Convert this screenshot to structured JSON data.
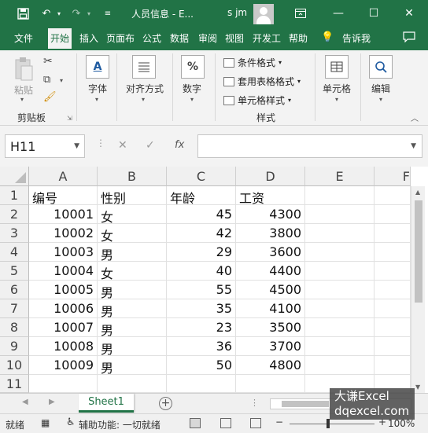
{
  "titlebar": {
    "title": "人员信息 - E...",
    "user": "s jm",
    "window": {
      "minimize": "—",
      "maximize": "☐",
      "close": "✕"
    },
    "icons": [
      "save-icon",
      "undo-icon",
      "redo-icon",
      "customize-qat-icon",
      "ribbon-display-icon"
    ]
  },
  "tabs": {
    "items": [
      "文件",
      "开始",
      "插入",
      "页面布",
      "公式",
      "数据",
      "审阅",
      "视图",
      "开发工",
      "帮助"
    ],
    "active": "开始",
    "tell_me": "告诉我"
  },
  "ribbon": {
    "clipboard": {
      "paste": "粘贴",
      "group_label": "剪贴板"
    },
    "font": {
      "label": "字体",
      "icon_text": "A"
    },
    "alignment": {
      "label": "对齐方式"
    },
    "number": {
      "label": "数字",
      "icon_text": "%"
    },
    "styles": {
      "conditional": "条件格式",
      "table": "套用表格格式",
      "cell_styles": "单元格样式",
      "group_label": "样式"
    },
    "cells": {
      "label": "单元格"
    },
    "editing": {
      "label": "编辑"
    }
  },
  "formula_bar": {
    "name_box": "H11",
    "cancel": "✕",
    "enter": "✓",
    "fx": "fx",
    "formula": ""
  },
  "grid": {
    "columns": [
      "A",
      "B",
      "C",
      "D",
      "E",
      "F"
    ],
    "rows": [
      "1",
      "2",
      "3",
      "4",
      "5",
      "6",
      "7",
      "8",
      "9",
      "10",
      "11"
    ],
    "data": [
      [
        "编号",
        "性别",
        "年龄",
        "工资"
      ],
      [
        "10001",
        "女",
        "45",
        "4300"
      ],
      [
        "10002",
        "女",
        "42",
        "3800"
      ],
      [
        "10003",
        "男",
        "29",
        "3600"
      ],
      [
        "10004",
        "女",
        "40",
        "4400"
      ],
      [
        "10005",
        "男",
        "55",
        "4500"
      ],
      [
        "10006",
        "男",
        "35",
        "4100"
      ],
      [
        "10007",
        "男",
        "23",
        "3500"
      ],
      [
        "10008",
        "男",
        "36",
        "3700"
      ],
      [
        "10009",
        "男",
        "50",
        "4800"
      ]
    ]
  },
  "sheets": {
    "tabs": [
      "Sheet1"
    ],
    "active": "Sheet1",
    "add": "+"
  },
  "status": {
    "ready": "就绪",
    "accessibility": "辅助功能: 一切就绪",
    "zoom": "100%"
  },
  "watermark": {
    "line1": "大谦Excel",
    "line2": "dqexcel.com"
  }
}
